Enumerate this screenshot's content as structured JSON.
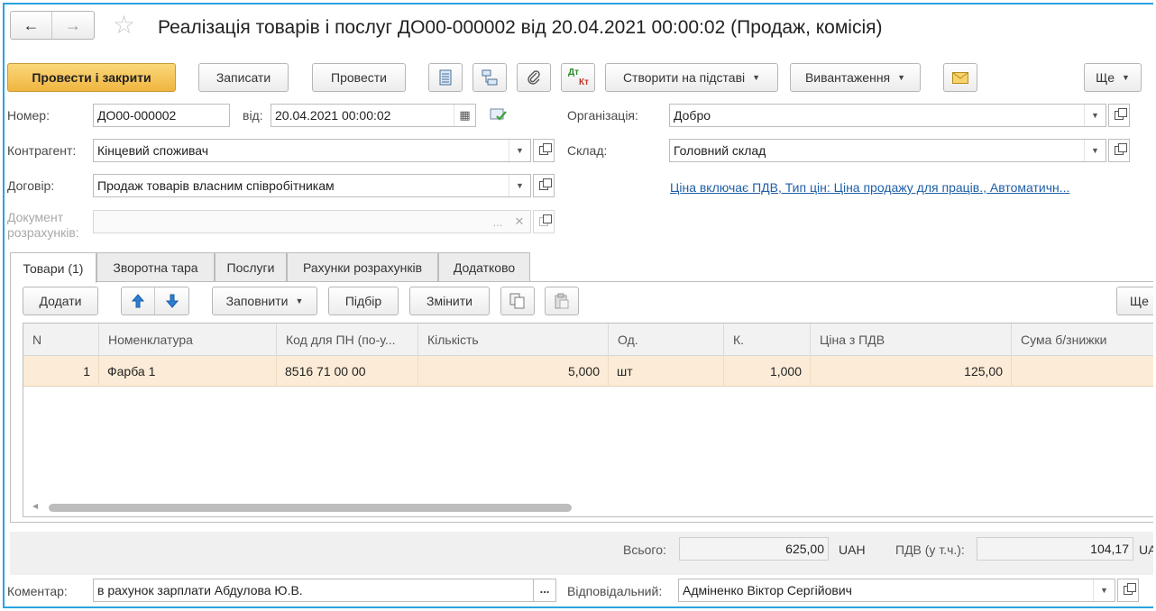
{
  "window": {
    "title": "Реалізація товарів і послуг ДО00-000002 від 20.04.2021 00:00:02 (Продаж, комісія)"
  },
  "toolbar": {
    "post_and_close": "Провести і закрити",
    "save": "Записати",
    "post": "Провести",
    "dt_kt_top": "Дт",
    "dt_kt_bottom": "Кт",
    "create_based_on": "Створити на підставі",
    "export": "Вивантаження",
    "more": "Ще"
  },
  "form": {
    "number_label": "Номер:",
    "number_value": "ДО00-000002",
    "date_label": "від:",
    "date_value": "20.04.2021 00:00:02",
    "organization_label": "Організація:",
    "organization_value": "Добро",
    "counterparty_label": "Контрагент:",
    "counterparty_value": "Кінцевий споживач",
    "warehouse_label": "Склад:",
    "warehouse_value": "Головний склад",
    "contract_label": "Договір:",
    "contract_value": "Продаж товарів власним співробітникам",
    "price_link": "Ціна включає ПДВ, Тип цін: Ціна продажу для праців., Автоматичн...",
    "settlement_doc_label": "Документ розрахунків:",
    "settlement_doc_value": "",
    "settlement_doc_dots": "..."
  },
  "tabs": [
    {
      "label": "Товари (1)"
    },
    {
      "label": "Зворотна тара"
    },
    {
      "label": "Послуги"
    },
    {
      "label": "Рахунки розрахунків"
    },
    {
      "label": "Додатково"
    }
  ],
  "table_toolbar": {
    "add": "Додати",
    "fill": "Заповнити",
    "selection": "Підбір",
    "change": "Змінити",
    "more": "Ще"
  },
  "table": {
    "columns": [
      "N",
      "Номенклатура",
      "Код для ПН (по-у...",
      "Кількість",
      "Од.",
      "К.",
      "Ціна з ПДВ",
      "Сума б/знижки"
    ],
    "rows": [
      [
        "1",
        "Фарба 1",
        "8516 71 00 00",
        "5,000",
        "шт",
        "1,000",
        "125,00",
        ""
      ]
    ]
  },
  "totals": {
    "total_label": "Всього:",
    "total_value": "625,00",
    "currency": "UAH",
    "vat_label": "ПДВ (у т.ч.):",
    "vat_value": "104,17",
    "vat_currency": "UA"
  },
  "bottom": {
    "comment_label": "Коментар:",
    "comment_value": "в рахунок зарплати Абдулова Ю.В.",
    "comment_dots": "...",
    "responsible_label": "Відповідальний:",
    "responsible_value": "Адміненко Віктор Сергійович"
  },
  "colors": {
    "accent_border": "#2aa3e0",
    "primary_button": "#f0b540",
    "selected_row": "#fcecd7",
    "link": "#1f5fa8",
    "arrow_blue": "#2a7fd4"
  }
}
